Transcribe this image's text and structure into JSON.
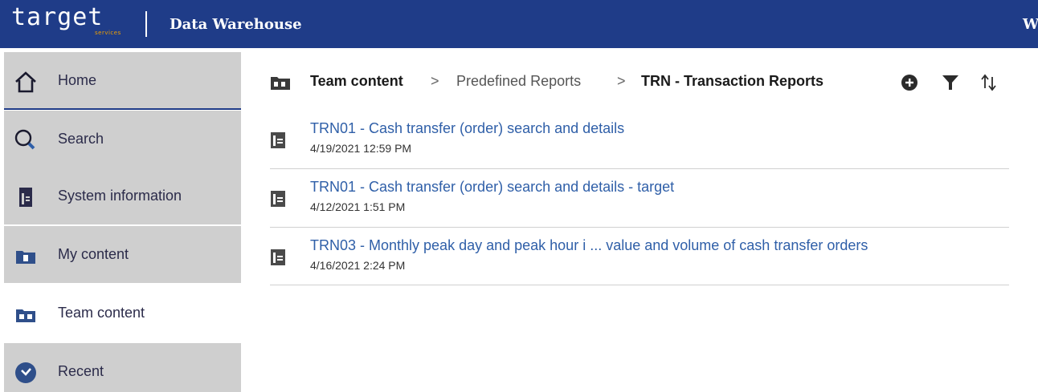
{
  "header": {
    "logo_text": "target",
    "logo_sub": "services",
    "app_title": "Data Warehouse",
    "right_text": "W",
    "bar_color": "#1f3c88"
  },
  "sidebar": {
    "items": [
      {
        "label": "Home",
        "icon": "home-icon",
        "active": false
      },
      {
        "label": "Search",
        "icon": "search-icon",
        "active": false
      },
      {
        "label": "System information",
        "icon": "report-icon",
        "active": false
      },
      {
        "label": "My content",
        "icon": "folder-user-icon",
        "active": false
      },
      {
        "label": "Team content",
        "icon": "folder-team-icon",
        "active": true
      },
      {
        "label": "Recent",
        "icon": "clock-icon",
        "active": false
      }
    ]
  },
  "breadcrumb": {
    "items": [
      "Team content",
      "Predefined Reports",
      "TRN - Transaction Reports"
    ],
    "separator": ">"
  },
  "toolbar": {
    "icons": [
      "add-icon",
      "filter-icon",
      "sort-icon"
    ]
  },
  "reports": [
    {
      "title": "TRN01 - Cash transfer (order) search and details",
      "date": "4/19/2021 12:59 PM"
    },
    {
      "title": "TRN01 - Cash transfer (order) search and details - target",
      "date": "4/12/2021 1:51 PM"
    },
    {
      "title": "TRN03 - Monthly peak day and peak hour i ... value and volume of cash transfer orders",
      "date": "4/16/2021 2:24 PM"
    }
  ]
}
